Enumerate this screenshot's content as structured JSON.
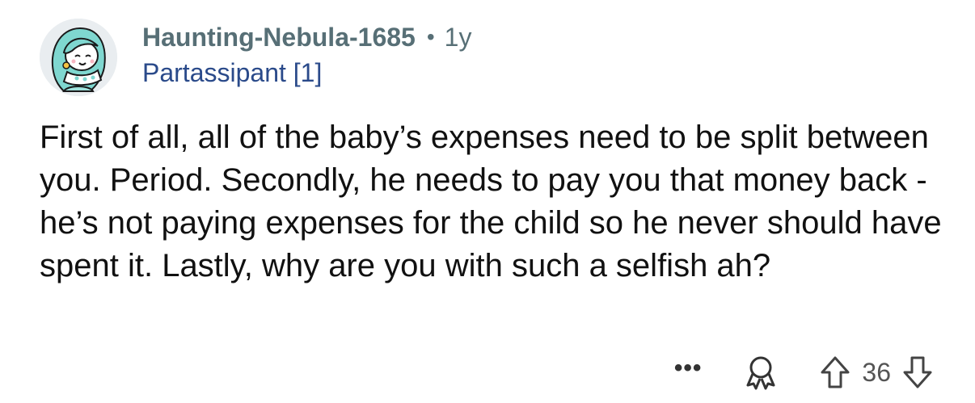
{
  "comment": {
    "author": "Haunting-Nebula-1685",
    "separator": "•",
    "age": "1y",
    "flair": "Partassipant [1]",
    "body": "First of all, all of the baby’s expenses need to be split between you.  Period.  Secondly, he needs to pay you that money back - he’s not paying expenses for the child so he never should have spent it.  Lastly, why are you with such a selfish ah?",
    "actions": {
      "more_label": "•••",
      "award_icon": "award-icon",
      "upvote_icon": "upvote-arrow-icon",
      "score": "36",
      "downvote_icon": "downvote-arrow-icon"
    }
  },
  "colors": {
    "meta": "#576f76",
    "flair": "#2a4a8a",
    "text": "#111111",
    "avatar_hair": "#7fd7d0",
    "avatar_bg": "#e9edf0"
  }
}
